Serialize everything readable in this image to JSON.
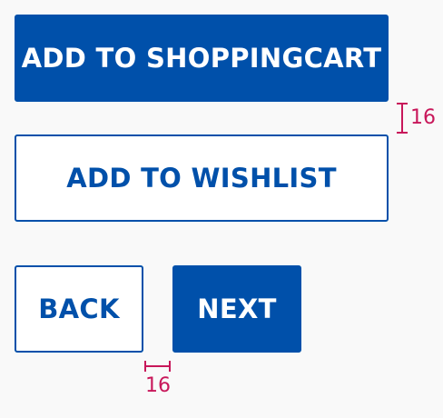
{
  "colors": {
    "background": "#f9f9f9",
    "primary": "#0050aa",
    "on_primary": "#ffffff",
    "secondary_bg": "#ffffff",
    "annotation": "#c8175a"
  },
  "buttons": {
    "add_to_cart_label": "ADD TO SHOPPINGCART",
    "add_to_wishlist_label": "ADD TO WISHLIST",
    "back_label": "BACK",
    "next_label": "NEXT"
  },
  "annotations": {
    "vertical_spacing_label": "16",
    "horizontal_spacing_label": "16"
  }
}
